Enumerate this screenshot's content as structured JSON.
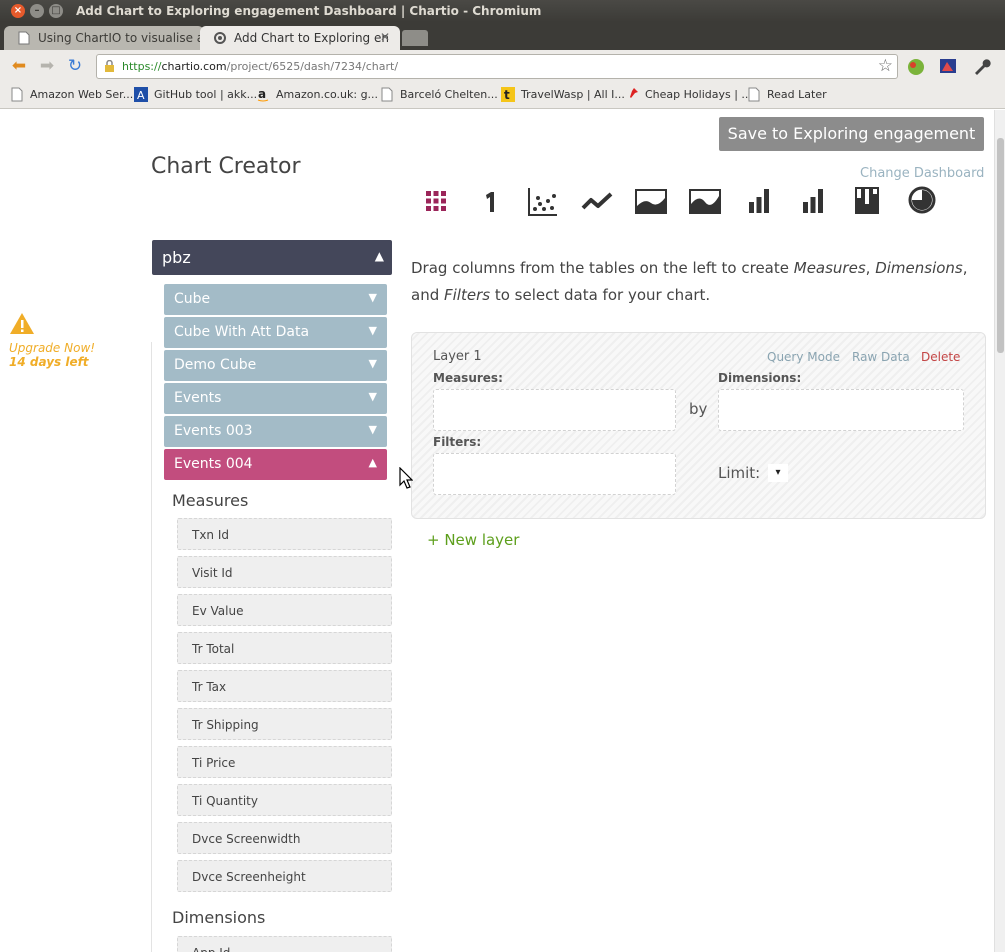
{
  "window": {
    "title": "Add Chart to Exploring engagement Dashboard | Chartio - Chromium",
    "close": "×",
    "min": "–",
    "max": "□"
  },
  "tabs": [
    {
      "label": "Using ChartIO to visualise a"
    },
    {
      "label": "Add Chart to Exploring en"
    }
  ],
  "address": {
    "scheme": "https://",
    "host": "chartio.com",
    "path": "/project/6525/dash/7234/chart/"
  },
  "bookmarks": [
    {
      "label": "Amazon Web Ser..."
    },
    {
      "label": "GitHub tool | akk..."
    },
    {
      "label": "Amazon.co.uk: g..."
    },
    {
      "label": "Barceló Chelten..."
    },
    {
      "label": "TravelWasp | All I..."
    },
    {
      "label": "Cheap Holidays | ..."
    },
    {
      "label": "Read Later"
    }
  ],
  "upgrade": {
    "line1": "Upgrade Now!",
    "line2": "14 days left"
  },
  "page": {
    "title": "Chart Creator",
    "save_button": "Save to Exploring engagement",
    "change_dashboard": "Change Dashboard"
  },
  "chart_types": [
    "table",
    "single-value",
    "scatter",
    "line",
    "area",
    "stacked-area",
    "bar",
    "stacked-bar",
    "column",
    "pie"
  ],
  "source": {
    "name": "pbz",
    "tables": [
      {
        "label": "Cube"
      },
      {
        "label": "Cube With Att Data"
      },
      {
        "label": "Demo Cube"
      },
      {
        "label": "Events"
      },
      {
        "label": "Events 003"
      },
      {
        "label": "Events 004"
      }
    ],
    "measures_title": "Measures",
    "measures": [
      "Txn Id",
      "Visit Id",
      "Ev Value",
      "Tr Total",
      "Tr Tax",
      "Tr Shipping",
      "Ti Price",
      "Ti Quantity",
      "Dvce Screenwidth",
      "Dvce Screenheight"
    ],
    "dimensions_title": "Dimensions",
    "dimensions": [
      "App Id"
    ]
  },
  "instructions": {
    "part1": "Drag columns from the tables on the left to create ",
    "measures": "Measures",
    "comma": ", ",
    "dimensions": "Dimensions",
    "part2": ",",
    "and": "and ",
    "filters": "Filters",
    "part3": " to select data for your chart."
  },
  "layer": {
    "title": "Layer 1",
    "query_mode": "Query Mode",
    "raw_data": "Raw Data",
    "delete": "Delete",
    "measures_label": "Measures:",
    "dimensions_label": "Dimensions:",
    "filters_label": "Filters:",
    "by": "by",
    "limit_label": "Limit:",
    "limit_value": "▾"
  },
  "new_layer": "+ New layer",
  "colors": {
    "source_header": "#44475a",
    "table_item": "#a3bbc7",
    "table_active": "#c24d7e",
    "chart_icon_active": "#9b2559",
    "new_layer": "#5d9f1c",
    "delete": "#c44545",
    "upgrade": "#f0ad28"
  }
}
